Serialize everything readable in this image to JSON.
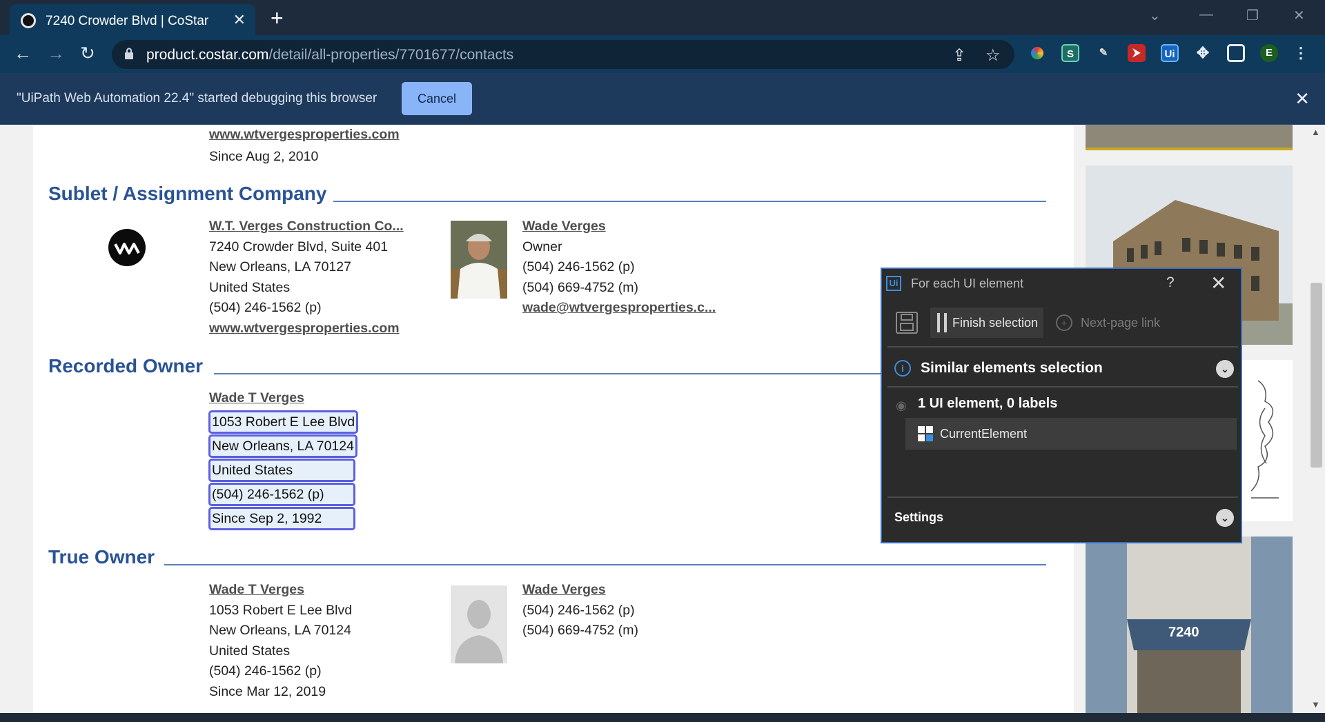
{
  "browser": {
    "tab_title": "7240 Crowder Blvd | CoStar",
    "tab_close": "✕",
    "new_tab": "+",
    "url_host": "product.costar.com",
    "url_path": "/detail/all-properties/7701677/contacts",
    "back": "←",
    "forward": "→",
    "reload": "↻",
    "extension_label_s": "S",
    "extension_label_ui": "Ui",
    "profile_initial": "E",
    "menu": "⋮"
  },
  "infobar": {
    "message": "\"UiPath Web Automation 22.4\" started debugging this browser",
    "cancel_label": "Cancel",
    "close": "✕"
  },
  "previous_section": {
    "website": "www.wtvergesproperties.com",
    "since": "Since Aug 2, 2010"
  },
  "sublet": {
    "heading": "Sublet / Assignment Company",
    "company_name": "W.T. Verges Construction Co...",
    "address1": "7240 Crowder Blvd, Suite 401",
    "address2": "New Orleans, LA 70127",
    "country": "United States",
    "phone": "(504) 246-1562 (p)",
    "website": "www.wtvergesproperties.com",
    "contact_name": "Wade Verges",
    "contact_title": "Owner",
    "contact_phone_p": "(504) 246-1562 (p)",
    "contact_phone_m": "(504) 669-4752 (m)",
    "contact_email": "wade@wtvergesproperties.c..."
  },
  "recorded_owner": {
    "heading": "Recorded Owner",
    "name": "Wade T Verges",
    "address1": "1053 Robert E Lee Blvd",
    "address2": "New Orleans, LA 70124",
    "country": "United States",
    "phone": "(504) 246-1562 (p)",
    "since": "Since Sep 2, 1992"
  },
  "true_owner": {
    "heading": "True Owner",
    "name": "Wade T Verges",
    "address1": "1053 Robert E Lee Blvd",
    "address2": "New Orleans, LA 70124",
    "country": "United States",
    "phone": "(504) 246-1562 (p)",
    "since": "Since Mar 12, 2019",
    "contact_name": "Wade Verges",
    "contact_phone_p": "(504) 246-1562 (p)",
    "contact_phone_m": "(504) 669-4752 (m)"
  },
  "side_images": {
    "building_sign": "7240"
  },
  "uipath_panel": {
    "title": "For each UI element",
    "logo": "Ui",
    "help": "?",
    "close": "✕",
    "finish_selection": "Finish selection",
    "next_page_link": "Next-page link",
    "similar_elements": "Similar elements selection",
    "element_count": "1 UI element, 0 labels",
    "current_element": "CurrentElement",
    "settings": "Settings",
    "expand_glyph": "⌄"
  },
  "colors": {
    "heading_blue": "#2a5396",
    "highlight_border": "#5b5fe0",
    "panel_bg": "#2b2b2b",
    "chrome_dark": "#1e2b3d",
    "toolbar": "#0f3a5c"
  }
}
